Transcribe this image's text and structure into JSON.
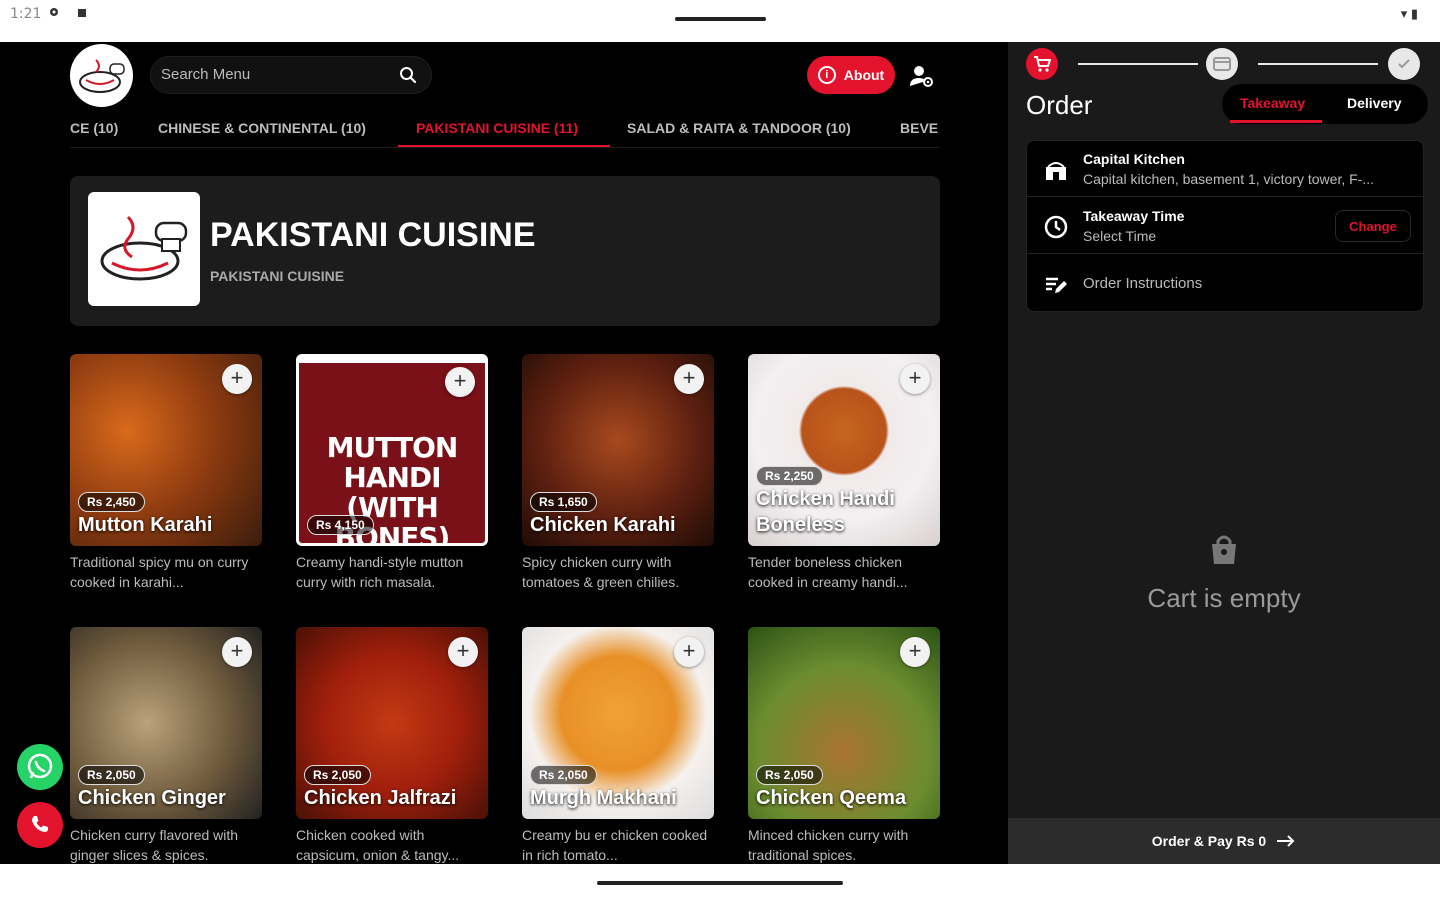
{
  "status": {
    "time": "1:21"
  },
  "search": {
    "placeholder": "Search Menu"
  },
  "header": {
    "about_label": "About"
  },
  "tabs": [
    {
      "label": "CE (10)"
    },
    {
      "label": "CHINESE & CONTINENTAL (10)"
    },
    {
      "label": "PAKISTANI CUISINE (11)"
    },
    {
      "label": "SALAD & RAITA & TANDOOR (10)"
    },
    {
      "label": "BEVE"
    }
  ],
  "category": {
    "title": "PAKISTANI CUISINE",
    "subtitle": "PAKISTANI CUISINE"
  },
  "items": [
    {
      "name": "Mutton Karahi",
      "price": "Rs 2,450",
      "desc": "Traditional spicy mu on curry cooked in karahi..."
    },
    {
      "name": "",
      "price": "Rs 4,150",
      "desc": "Creamy handi-style mutton curry with rich masala.",
      "image_text": "MUTTON HANDI (WITH BONES)"
    },
    {
      "name": "Chicken Karahi",
      "price": "Rs 1,650",
      "desc": "Spicy chicken curry with tomatoes & green chilies."
    },
    {
      "name": "Chicken Handi Boneless",
      "price": "Rs 2,250",
      "desc": "Tender boneless chicken cooked in creamy handi..."
    },
    {
      "name": "Chicken Ginger",
      "price": "Rs 2,050",
      "desc": "Chicken curry flavored with ginger slices & spices."
    },
    {
      "name": "Chicken Jalfrazi",
      "price": "Rs 2,050",
      "desc": "Chicken cooked with capsicum, onion & tangy..."
    },
    {
      "name": "Murgh Makhani",
      "price": "Rs 2,050",
      "desc": "Creamy bu er chicken cooked in rich tomato..."
    },
    {
      "name": "Chicken Qeema",
      "price": "Rs 2,050",
      "desc": "Minced chicken curry with traditional spices."
    }
  ],
  "order": {
    "title": "Order",
    "modes": {
      "takeaway": "Takeaway",
      "delivery": "Delivery"
    },
    "restaurant": {
      "name": "Capital Kitchen",
      "address": "Capital kitchen, basement 1, victory tower, F-..."
    },
    "takeaway_time": {
      "label": "Takeaway Time",
      "value": "Select Time",
      "change": "Change"
    },
    "instructions": "Order Instructions",
    "empty_text": "Cart is empty",
    "pay_label": "Order & Pay Rs 0"
  },
  "colors": {
    "accent": "#e3122d",
    "background": "#000000",
    "panel": "#1a1a1a"
  }
}
